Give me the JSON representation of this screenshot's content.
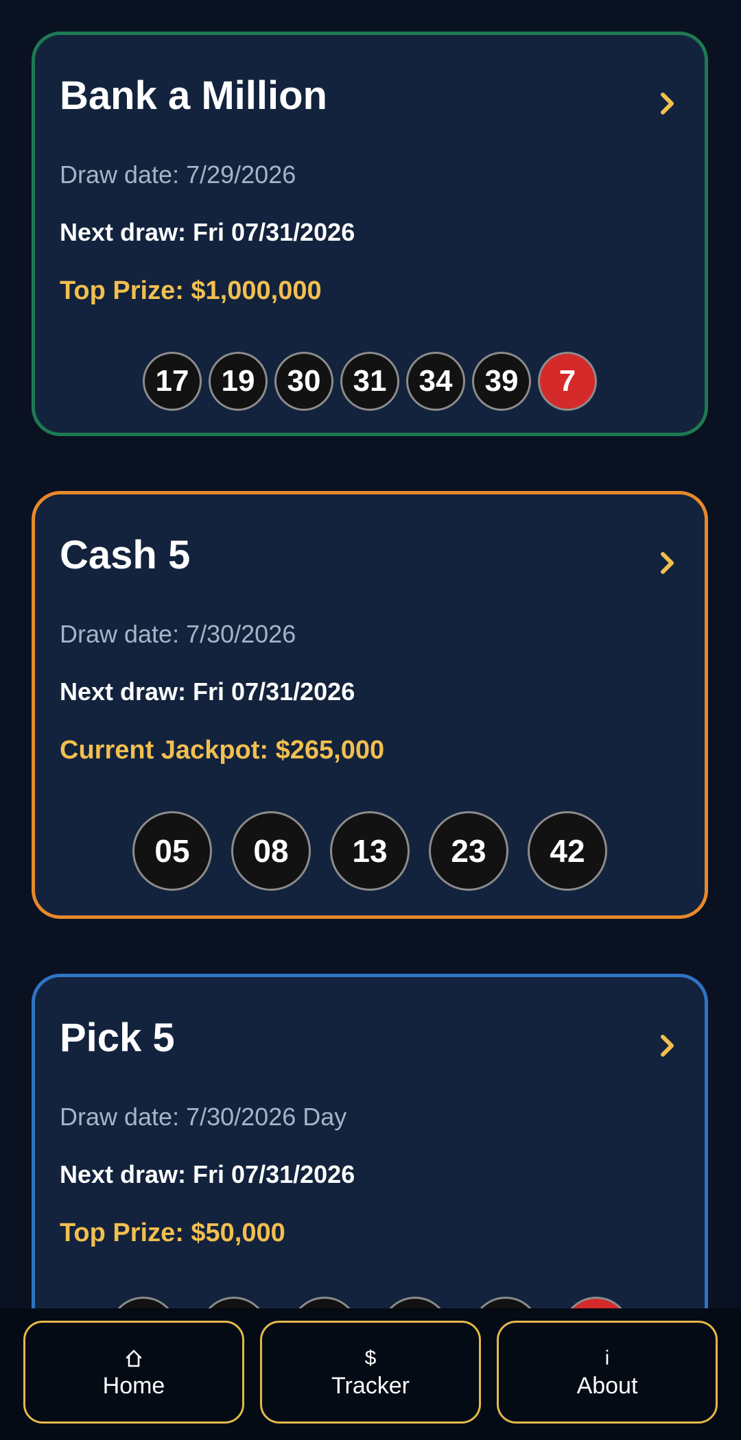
{
  "cards": [
    {
      "title": "Bank a Million",
      "draw_date": "Draw date: 7/29/2026",
      "next_draw": "Next draw: Fri 07/31/2026",
      "prize": "Top Prize: $1,000,000",
      "numbers": [
        "17",
        "19",
        "30",
        "31",
        "34",
        "39"
      ],
      "bonus": "7",
      "border_color": "#1e7a52"
    },
    {
      "title": "Cash 5",
      "draw_date": "Draw date: 7/30/2026",
      "next_draw": "Next draw: Fri 07/31/2026",
      "prize": "Current Jackpot: $265,000",
      "numbers": [
        "05",
        "08",
        "13",
        "23",
        "42"
      ],
      "border_color": "#e8892a"
    },
    {
      "title": "Pick 5",
      "draw_date": "Draw date: 7/30/2026 Day",
      "next_draw": "Next draw: Fri 07/31/2026",
      "prize": "Top Prize: $50,000",
      "border_color": "#2f73c3"
    }
  ],
  "chevron_icon": "chevron-right-icon",
  "nav": [
    {
      "icon": "⌂",
      "icon_name": "home-icon",
      "label": "Home"
    },
    {
      "icon": "$",
      "icon_name": "dollar-icon",
      "label": "Tracker"
    },
    {
      "icon": "i",
      "icon_name": "info-icon",
      "label": "About"
    }
  ],
  "colors": {
    "background": "#0a1222",
    "card_background": "#13233d",
    "accent_gold": "#f2bf4f",
    "bonus_ball": "#d52a2a",
    "nav_border": "#e6b84a"
  }
}
